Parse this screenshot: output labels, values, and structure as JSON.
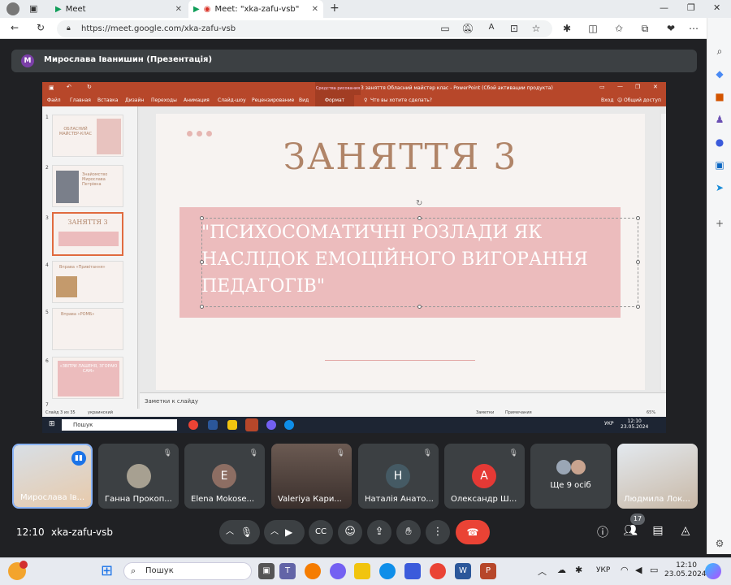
{
  "browser": {
    "tabs": [
      {
        "label": "Meet"
      },
      {
        "label": "Meet: \"xka-zafu-vsb\""
      }
    ],
    "url": "https://meet.google.com/xka-zafu-vsb"
  },
  "meet": {
    "presenter_initial": "M",
    "presenter_label": "Мирослава Іванишин (Презентація)",
    "time": "12:10",
    "meeting_code": "xka-zafu-vsb",
    "participants_count": "17",
    "tiles": [
      {
        "name": "Мирослава Ів...",
        "initial": "",
        "color": "#3c4043"
      },
      {
        "name": "Ганна Прокоп...",
        "initial": "",
        "color": "#3c4043"
      },
      {
        "name": "Elena Mokose...",
        "initial": "E",
        "color": "#8d6e63"
      },
      {
        "name": "Valeriya Кари...",
        "initial": "",
        "color": "#3c4043"
      },
      {
        "name": "Наталія Анато...",
        "initial": "Н",
        "color": "#455a64"
      },
      {
        "name": "Олександр Ш...",
        "initial": "А",
        "color": "#e53935"
      },
      {
        "name": "Ще 9 осіб",
        "initial": "",
        "color": "#3c4043"
      },
      {
        "name": "Людмила Лок...",
        "initial": "",
        "color": "#3c4043"
      }
    ]
  },
  "ppt": {
    "window_title": "3 заняття Обласний майстер клас - PowerPoint (Сбой активации продукта)",
    "context_tab": "Средства рисования",
    "ribbon": [
      "Файл",
      "Главная",
      "Вставка",
      "Дизайн",
      "Переходы",
      "Анимация",
      "Слайд-шоу",
      "Рецензирование",
      "Вид",
      "Формат"
    ],
    "tell_me": "Что вы хотите сделать?",
    "signin": "Вход",
    "share": "Общий доступ",
    "thumbs": [
      {
        "num": "1",
        "text": "ОБЛАСНИЙ МАЙСТЕР-КЛАС"
      },
      {
        "num": "2",
        "text": "Знайомство Мирослава Петрівна"
      },
      {
        "num": "3",
        "text": "ЗАНЯТТЯ 3"
      },
      {
        "num": "4",
        "text": "Вправа «Привітання»"
      },
      {
        "num": "5",
        "text": "Вправа «РОМБ»"
      },
      {
        "num": "6",
        "text": "«ЗВІТРИ ЛАШЕНЯ, ЗГОРАЮ САМ»"
      },
      {
        "num": "7",
        "text": ""
      }
    ],
    "slide_title": "ЗАНЯТТЯ 3",
    "slide_body": "\"ПСИХОСОМАТИЧНІ РОЗЛАДИ ЯК НАСЛІДОК ЕМОЦІЙНОГО ВИГОРАННЯ ПЕДАГОГІВ\"",
    "notes_placeholder": "Заметки к слайду",
    "status_left": "Слайд 3 из 35",
    "status_lang": "украинский",
    "status_notes": "Заметки",
    "status_comments": "Примечания",
    "zoom": "65%",
    "inner_search": "Пошук",
    "inner_lang": "УКР",
    "inner_time": "12:10",
    "inner_date": "23.05.2024"
  },
  "taskbar": {
    "search": "Пошук",
    "lang": "УКР",
    "time": "12:10",
    "date": "23.05.2024"
  }
}
